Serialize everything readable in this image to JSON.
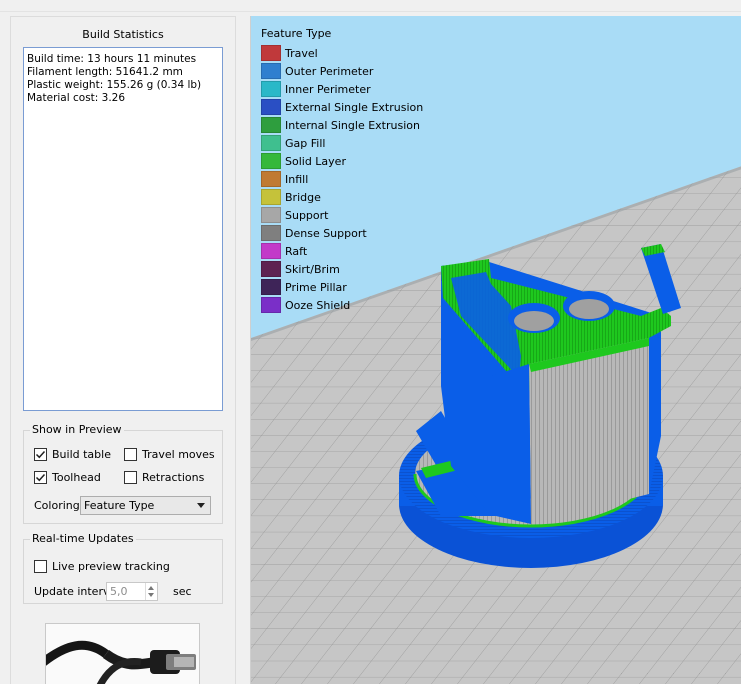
{
  "build_statistics": {
    "title": "Build Statistics",
    "lines": [
      "Build time: 13 hours 11 minutes",
      "Filament length: 51641.2 mm",
      "Plastic weight: 155.26 g (0.34 lb)",
      "Material cost: 3.26"
    ]
  },
  "show_in_preview": {
    "title": "Show in Preview",
    "build_table": {
      "label": "Build table",
      "checked": true
    },
    "travel_moves": {
      "label": "Travel moves",
      "checked": false
    },
    "toolhead": {
      "label": "Toolhead",
      "checked": true
    },
    "retractions": {
      "label": "Retractions",
      "checked": false
    },
    "coloring_label": "Coloring",
    "coloring_value": "Feature Type"
  },
  "realtime_updates": {
    "title": "Real-time Updates",
    "live_preview": {
      "label": "Live preview tracking",
      "checked": false
    },
    "interval_label": "Update interval",
    "interval_value": "5,0",
    "interval_unit": "sec"
  },
  "legend": {
    "title": "Feature Type",
    "items": [
      {
        "label": "Travel",
        "color": "#c0393b"
      },
      {
        "label": "Outer Perimeter",
        "color": "#2f7fcf"
      },
      {
        "label": "Inner Perimeter",
        "color": "#2ab8c8"
      },
      {
        "label": "External Single Extrusion",
        "color": "#2a4fc4"
      },
      {
        "label": "Internal Single Extrusion",
        "color": "#2e9e3e"
      },
      {
        "label": "Gap Fill",
        "color": "#3fbf8f"
      },
      {
        "label": "Solid Layer",
        "color": "#35b83a"
      },
      {
        "label": "Infill",
        "color": "#c07a32"
      },
      {
        "label": "Bridge",
        "color": "#c5c23a"
      },
      {
        "label": "Support",
        "color": "#a7a7a7"
      },
      {
        "label": "Dense Support",
        "color": "#7f7f7f"
      },
      {
        "label": "Raft",
        "color": "#c23ac9"
      },
      {
        "label": "Skirt/Brim",
        "color": "#5e2352"
      },
      {
        "label": "Prime Pillar",
        "color": "#3e2458"
      },
      {
        "label": "Ooze Shield",
        "color": "#7a2fc8"
      }
    ]
  },
  "colors": {
    "model_blue": "#0a5ee8",
    "model_green": "#1ec81e",
    "support_gray": "#b4b4b4",
    "bed_gray": "#c6c6c6",
    "sky": "#a9dcf6"
  }
}
